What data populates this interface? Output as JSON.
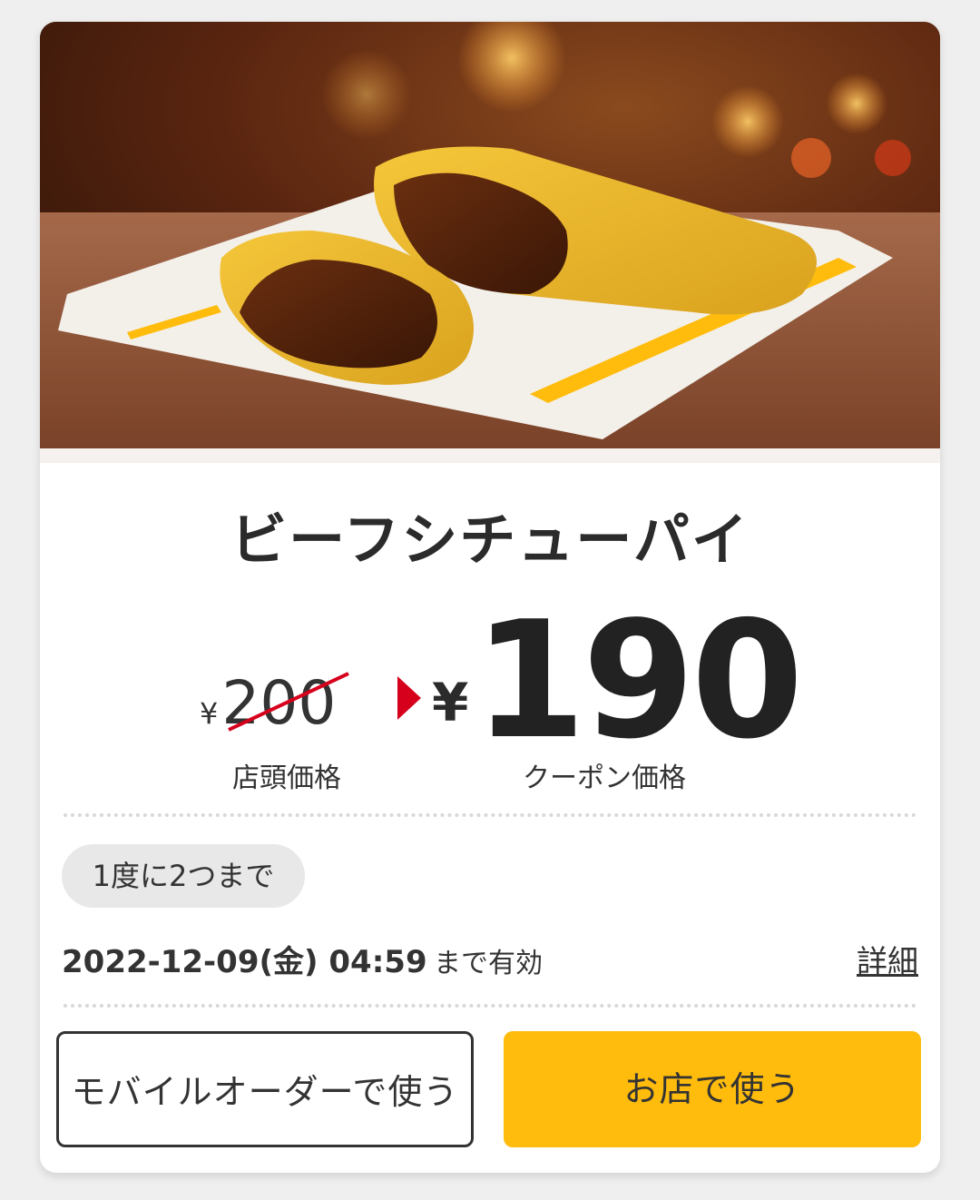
{
  "product": {
    "name": "ビーフシチューパイ",
    "image": "beef-stew-pie-photo"
  },
  "pricing": {
    "original_currency": "¥",
    "original_value": "200",
    "original_label": "店頭価格",
    "coupon_currency": "¥",
    "coupon_value": "190",
    "coupon_label": "クーポン価格"
  },
  "limit": {
    "text": "1度に2つまで"
  },
  "expiry": {
    "date": "2022-12-09(金) 04:59",
    "suffix": "まで有効"
  },
  "details_label": "詳細",
  "buttons": {
    "mobile_order": "モバイルオーダーで使う",
    "in_store": "お店で使う"
  },
  "colors": {
    "accent": "#ffbc0d",
    "arrow": "#d6001c",
    "strike": "#d6001c"
  }
}
